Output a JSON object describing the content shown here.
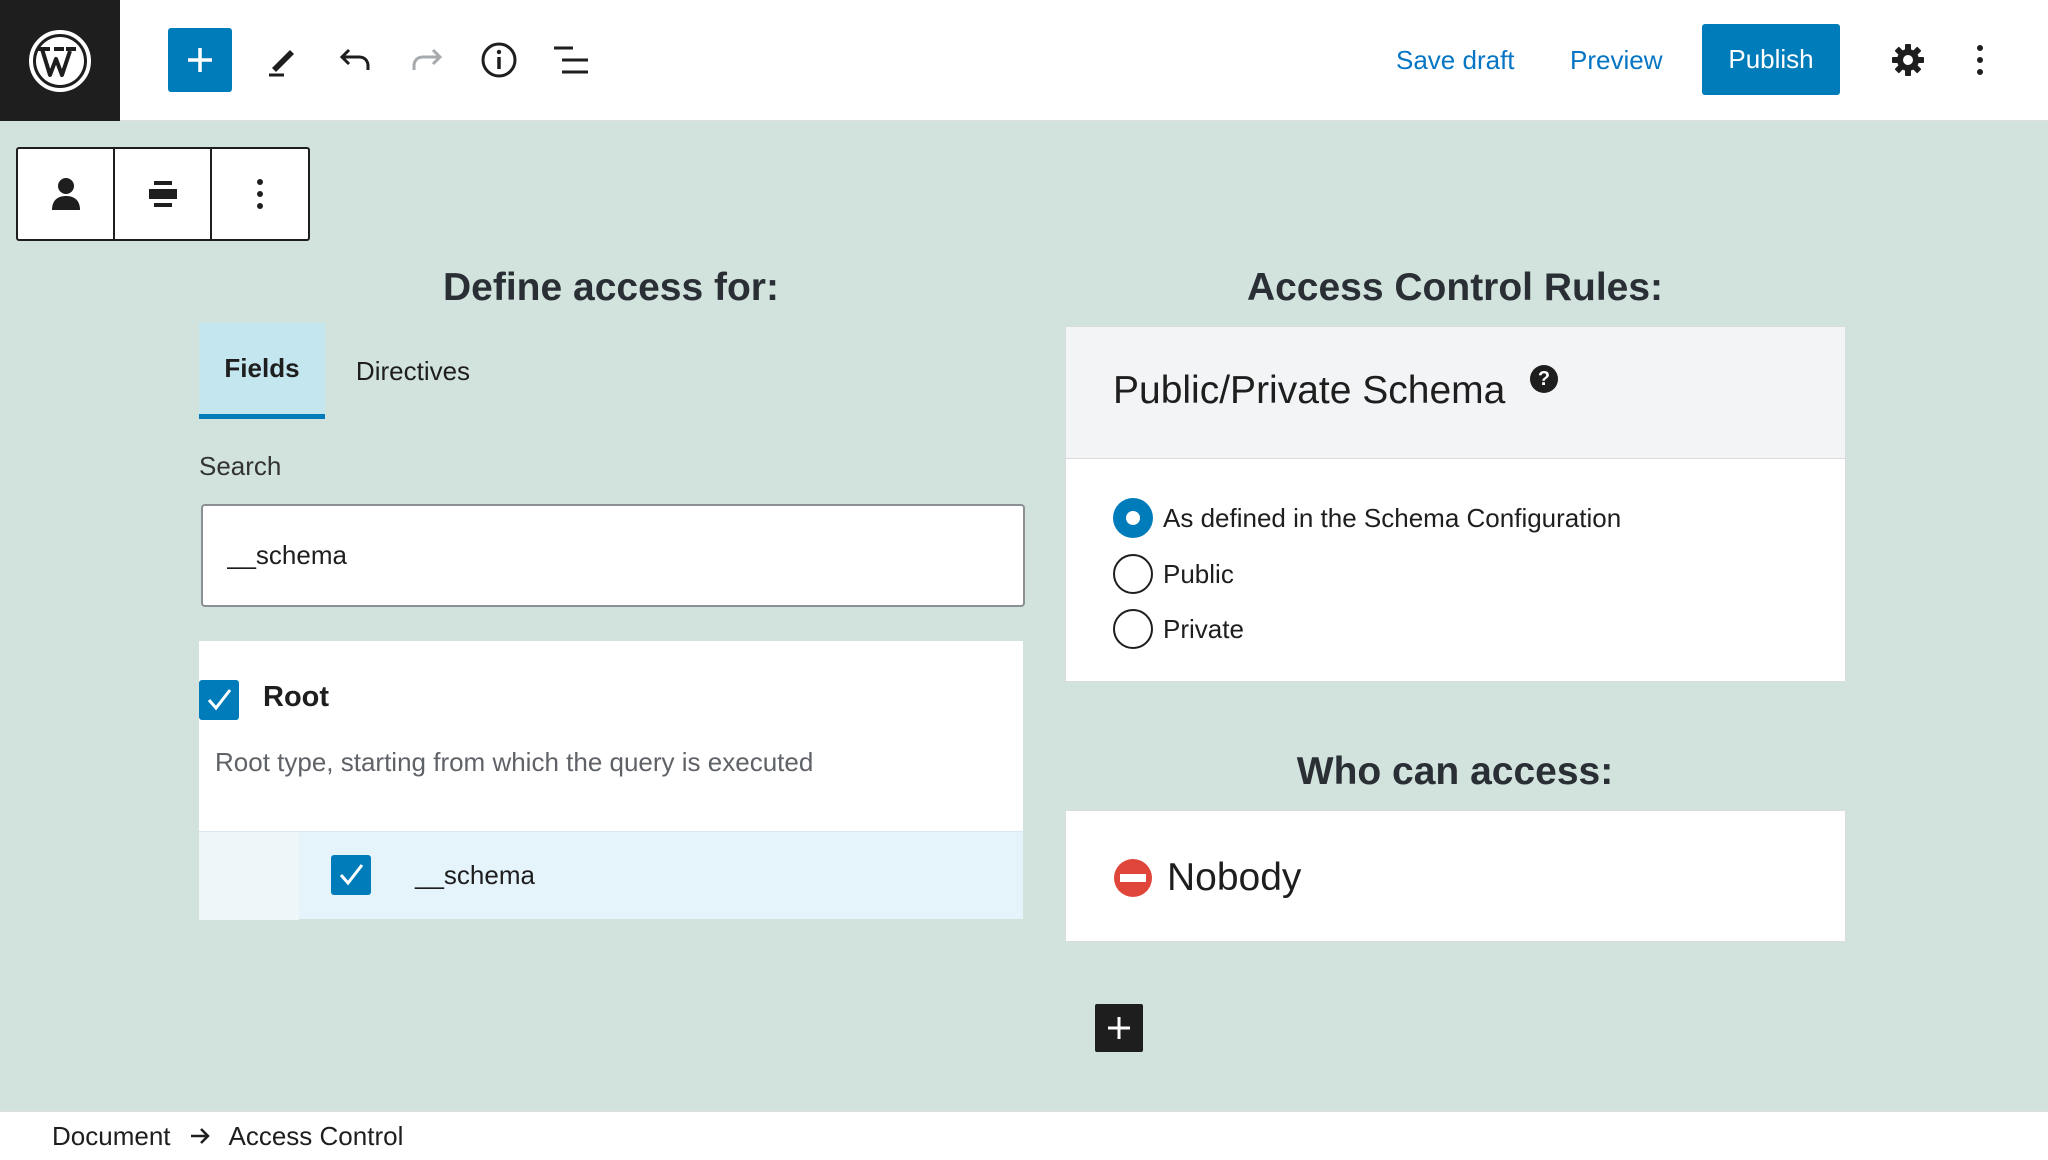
{
  "header": {
    "logo_icon": "wordpress-logo-icon",
    "tools": [
      "plus-icon",
      "pencil-icon",
      "undo-icon",
      "redo-icon",
      "info-icon",
      "list-view-icon"
    ],
    "save_draft_label": "Save draft",
    "preview_label": "Preview",
    "publish_label": "Publish",
    "settings_icon": "gear-icon",
    "options_icon": "vertical-ellipsis-icon"
  },
  "block_toolbar": {
    "items": [
      "user-icon",
      "align-icon",
      "vertical-ellipsis-icon"
    ]
  },
  "left": {
    "heading": "Define access for:",
    "tabs": [
      {
        "label": "Fields",
        "active": true
      },
      {
        "label": "Directives",
        "active": false
      }
    ],
    "search": {
      "label": "Search",
      "value": "__schema"
    },
    "root": {
      "label": "Root",
      "checked": true,
      "description": "Root type, starting from which the query is executed"
    },
    "fields": [
      {
        "label": "__schema",
        "checked": true
      }
    ]
  },
  "right": {
    "rules_heading": "Access Control Rules:",
    "schema_panel": {
      "title": "Public/Private Schema",
      "help_icon": "question-icon",
      "options": [
        {
          "label": "As defined in the Schema Configuration",
          "checked": true
        },
        {
          "label": "Public",
          "checked": false
        },
        {
          "label": "Private",
          "checked": false
        }
      ]
    },
    "who_heading": "Who can access:",
    "who_panel": {
      "icon": "no-entry-icon",
      "label": "Nobody"
    },
    "add_block_icon": "plus-icon"
  },
  "footer": {
    "breadcrumbs": [
      "Document",
      "Access Control"
    ],
    "separator_icon": "arrow-right-icon"
  },
  "colors": {
    "accent": "#007cba",
    "canvas": "#d2e3dd",
    "tab_active_bg": "#c4e6ee",
    "sub_row_bg": "#e5f3fb",
    "dark": "#1e1e1e"
  }
}
